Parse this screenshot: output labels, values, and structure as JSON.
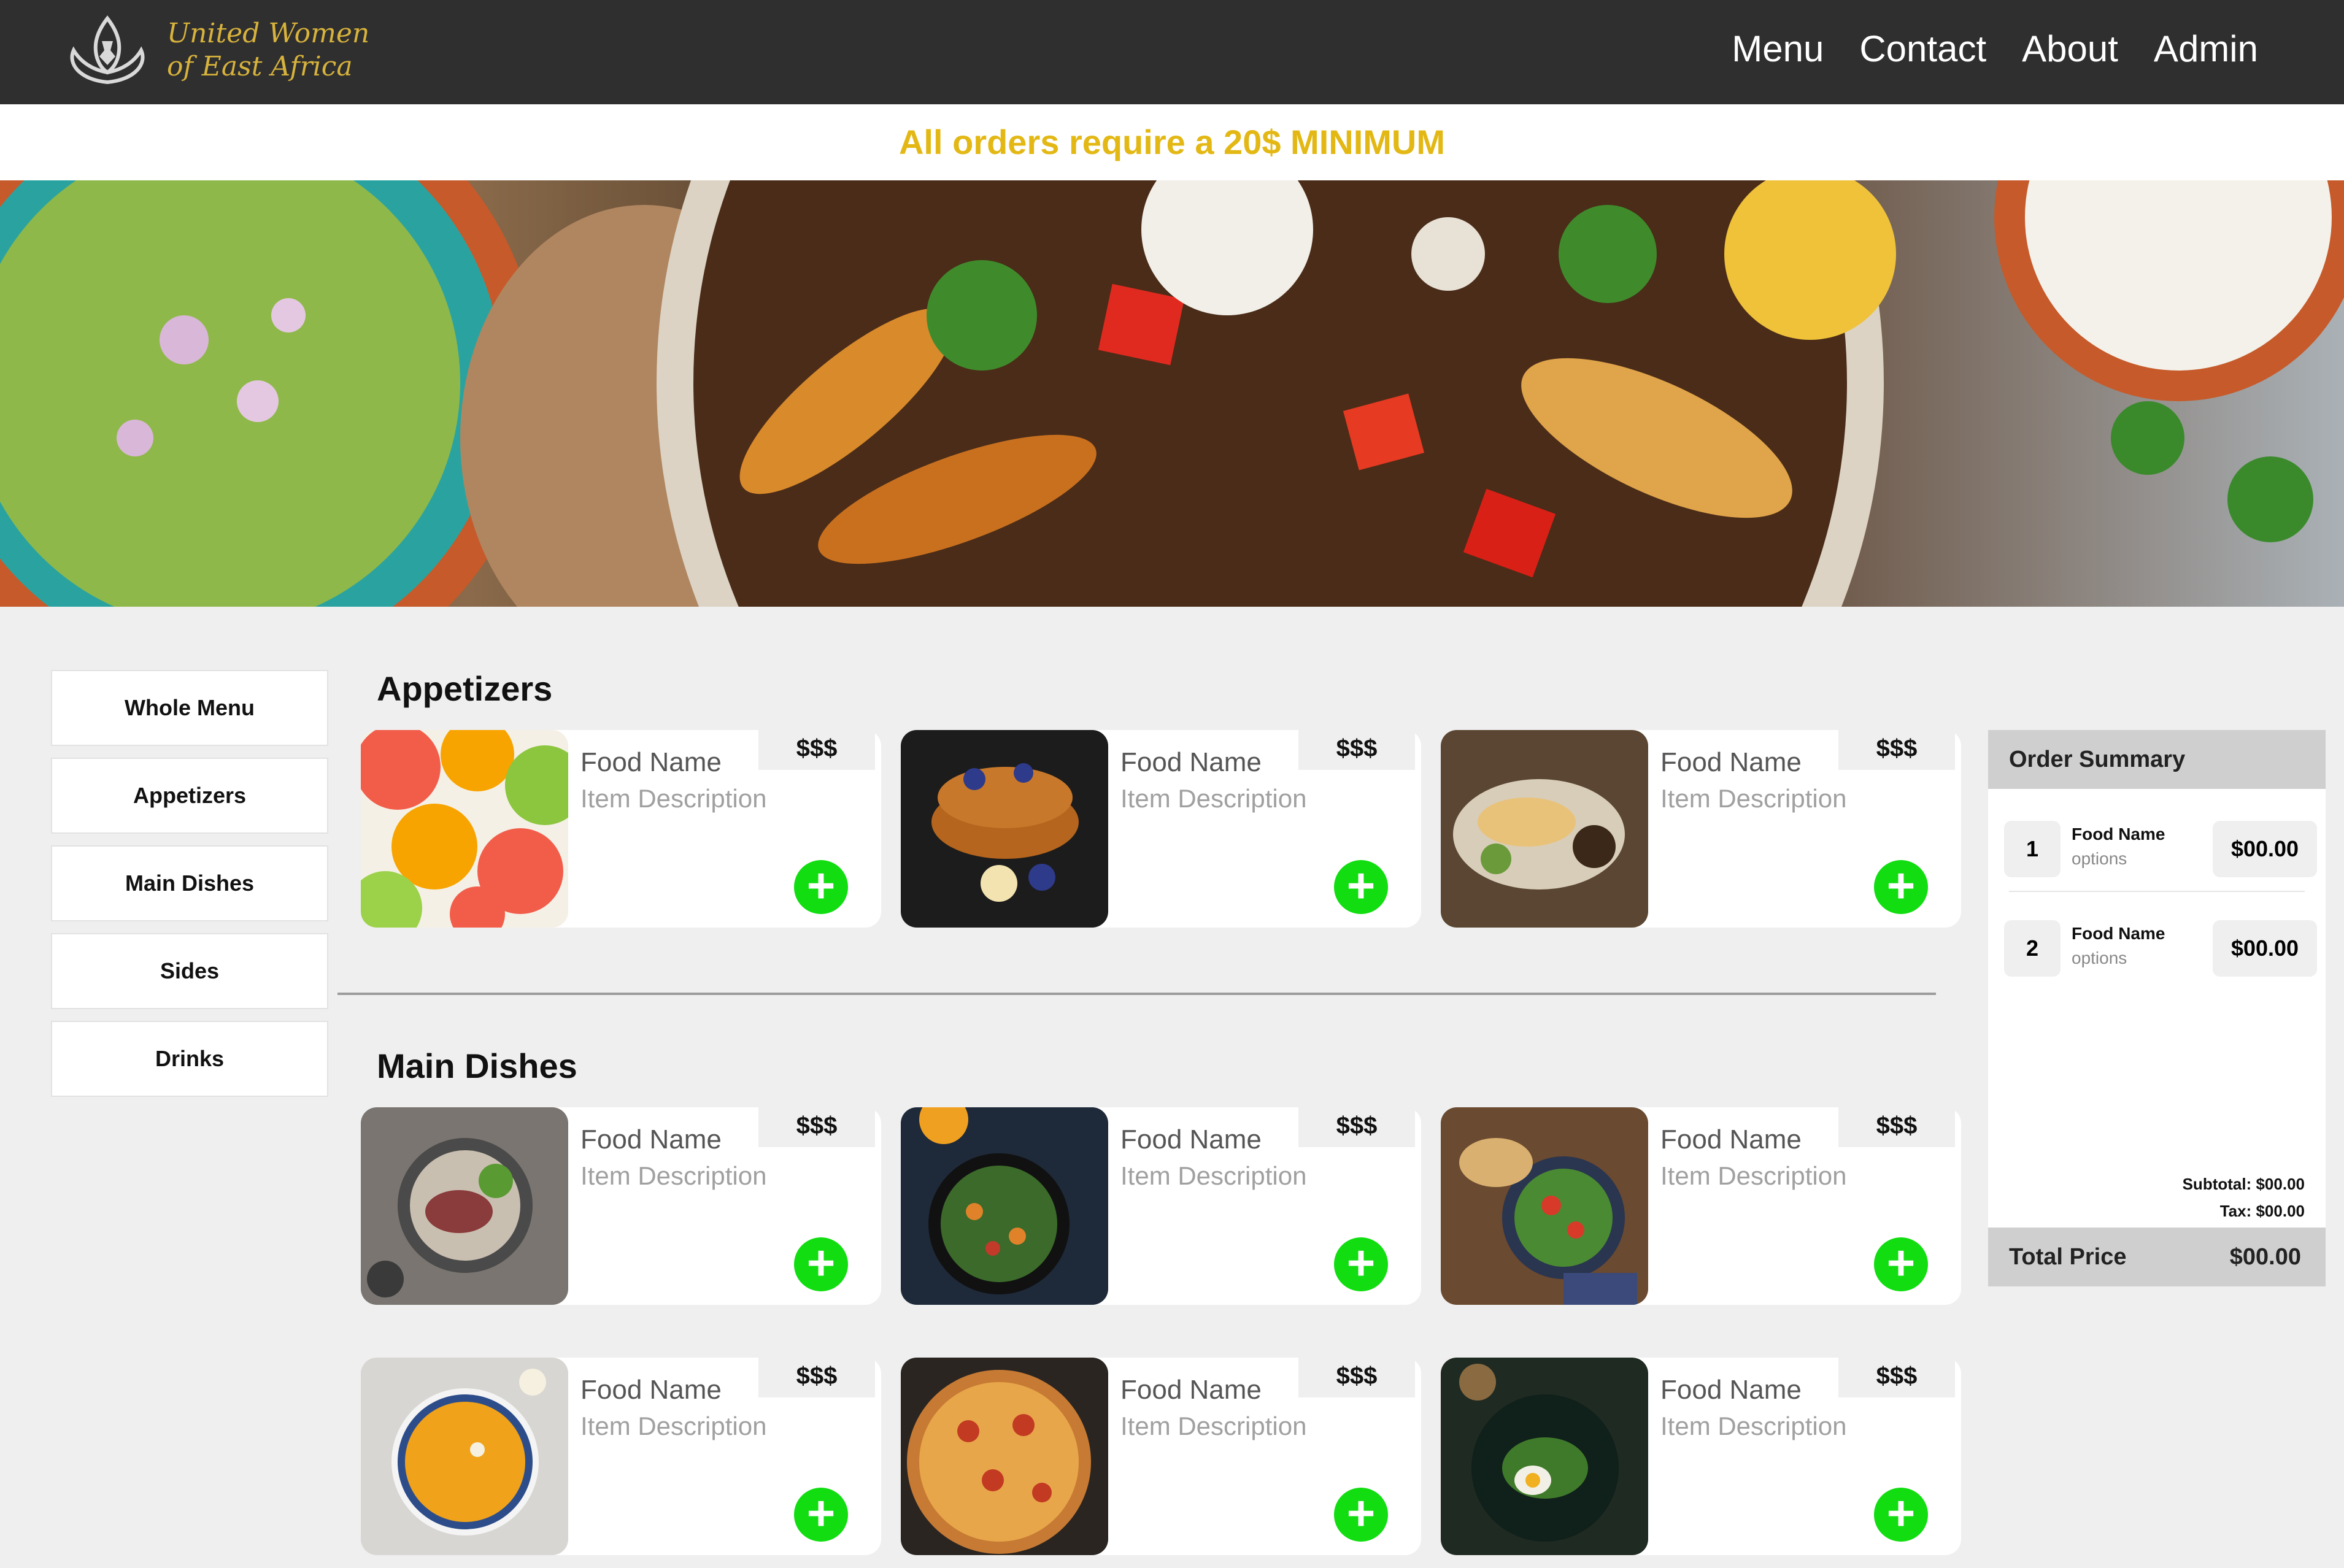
{
  "brand": {
    "line1": "United Women",
    "line2": "of East Africa"
  },
  "nav": [
    "Menu",
    "Contact",
    "About",
    "Admin"
  ],
  "banner": "All orders require a 20$ MINIMUM",
  "sidebar": [
    "Whole Menu",
    "Appetizers",
    "Main Dishes",
    "Sides",
    "Drinks"
  ],
  "sections": {
    "appetizers": {
      "title": "Appetizers",
      "items": [
        {
          "name": "Food Name",
          "description": "Item Description",
          "price": "$$$",
          "photo": "citrus-slices"
        },
        {
          "name": "Food Name",
          "description": "Item Description",
          "price": "$$$",
          "photo": "french-toast"
        },
        {
          "name": "Food Name",
          "description": "Item Description",
          "price": "$$$",
          "photo": "grilled-plate"
        }
      ]
    },
    "main_dishes": {
      "title": "Main Dishes",
      "items": [
        {
          "name": "Food Name",
          "description": "Item Description",
          "price": "$$$",
          "photo": "steak-salad"
        },
        {
          "name": "Food Name",
          "description": "Item Description",
          "price": "$$$",
          "photo": "green-salad"
        },
        {
          "name": "Food Name",
          "description": "Item Description",
          "price": "$$$",
          "photo": "veggie-bowl"
        },
        {
          "name": "Food Name",
          "description": "Item Description",
          "price": "$$$",
          "photo": "squash-soup"
        },
        {
          "name": "Food Name",
          "description": "Item Description",
          "price": "$$$",
          "photo": "pizza"
        },
        {
          "name": "Food Name",
          "description": "Item Description",
          "price": "$$$",
          "photo": "egg-plate"
        }
      ]
    }
  },
  "add_icon": "plus-circle-icon",
  "order_summary": {
    "title": "Order Summary",
    "items": [
      {
        "qty": "1",
        "name": "Food Name",
        "options": "options",
        "price": "$00.00"
      },
      {
        "qty": "2",
        "name": "Food Name",
        "options": "options",
        "price": "$00.00"
      }
    ],
    "subtotal": "Subtotal: $00.00",
    "tax": "Tax: $00.00",
    "total_label": "Total Price",
    "total_value": "$00.00"
  },
  "colors": {
    "topbar": "#2f2f2f",
    "brand_gold": "#d7b23c",
    "banner_text": "#e3b815",
    "add_green": "#11dd11"
  }
}
